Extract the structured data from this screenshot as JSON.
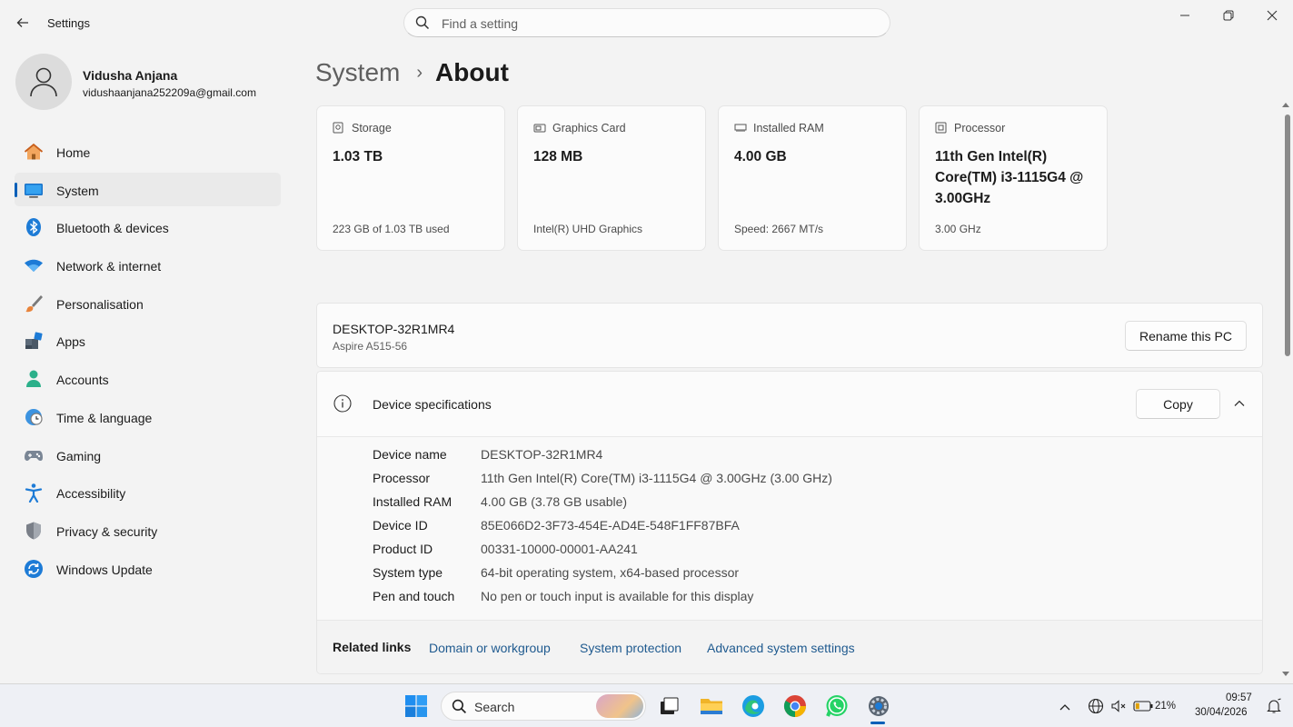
{
  "window": {
    "title": "Settings",
    "search_placeholder": "Find a setting"
  },
  "user": {
    "name": "Vidusha Anjana",
    "email": "vidushaanjana252209a@gmail.com"
  },
  "nav": [
    {
      "label": "Home",
      "icon": "home-icon"
    },
    {
      "label": "System",
      "icon": "system-icon",
      "active": true
    },
    {
      "label": "Bluetooth & devices",
      "icon": "bluetooth-icon"
    },
    {
      "label": "Network & internet",
      "icon": "wifi-icon"
    },
    {
      "label": "Personalisation",
      "icon": "brush-icon"
    },
    {
      "label": "Apps",
      "icon": "apps-icon"
    },
    {
      "label": "Accounts",
      "icon": "accounts-icon"
    },
    {
      "label": "Time & language",
      "icon": "clock-globe-icon"
    },
    {
      "label": "Gaming",
      "icon": "gamepad-icon"
    },
    {
      "label": "Accessibility",
      "icon": "accessibility-icon"
    },
    {
      "label": "Privacy & security",
      "icon": "shield-icon"
    },
    {
      "label": "Windows Update",
      "icon": "update-icon"
    }
  ],
  "breadcrumb": {
    "parent": "System",
    "separator": "›",
    "current": "About"
  },
  "cards": [
    {
      "title": "Storage",
      "value": "1.03 TB",
      "sub": "223 GB of 1.03 TB used",
      "icon": "storage-icon"
    },
    {
      "title": "Graphics Card",
      "value": "128 MB",
      "sub": "Intel(R) UHD Graphics",
      "icon": "gpu-icon"
    },
    {
      "title": "Installed RAM",
      "value": "4.00 GB",
      "sub": "Speed: 2667 MT/s",
      "icon": "ram-icon"
    },
    {
      "title": "Processor",
      "value": "11th Gen Intel(R) Core(TM) i3-1115G4 @ 3.00GHz",
      "sub": "3.00 GHz",
      "icon": "cpu-icon"
    }
  ],
  "pc": {
    "name": "DESKTOP-32R1MR4",
    "model": "Aspire A515-56",
    "rename_label": "Rename this PC"
  },
  "specs": {
    "title": "Device specifications",
    "copy_label": "Copy",
    "rows": [
      {
        "key": "Device name",
        "value": "DESKTOP-32R1MR4"
      },
      {
        "key": "Processor",
        "value": "11th Gen Intel(R) Core(TM) i3-1115G4 @ 3.00GHz (3.00 GHz)"
      },
      {
        "key": "Installed RAM",
        "value": "4.00 GB (3.78 GB usable)"
      },
      {
        "key": "Device ID",
        "value": "85E066D2-3F73-454E-AD4E-548F1FF87BFA"
      },
      {
        "key": "Product ID",
        "value": "00331-10000-00001-AA241"
      },
      {
        "key": "System type",
        "value": "64-bit operating system, x64-based processor"
      },
      {
        "key": "Pen and touch",
        "value": "No pen or touch input is available for this display"
      }
    ]
  },
  "related": {
    "title": "Related links",
    "links": [
      "Domain or workgroup",
      "System protection",
      "Advanced system settings"
    ]
  },
  "taskbar": {
    "search_label": "Search",
    "battery": "21%",
    "time": "09:57",
    "date": "30/04/2026"
  },
  "colors": {
    "accent": "#005fb8",
    "link": "#1f5a8f"
  }
}
